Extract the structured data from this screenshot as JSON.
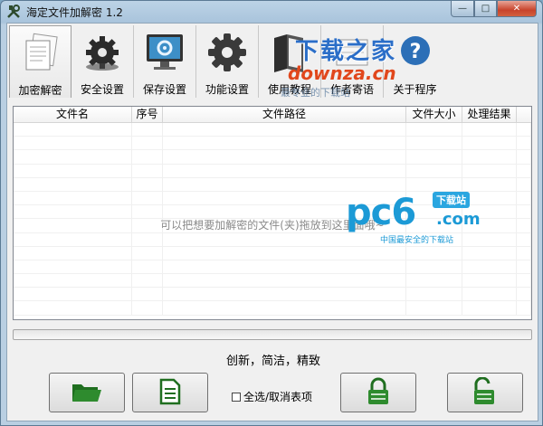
{
  "window": {
    "title": "海定文件加解密 1.2",
    "controls": [
      "minimize",
      "maximize",
      "close"
    ]
  },
  "toolbar": {
    "items": [
      {
        "label": "加密解密",
        "icon": "documents-icon",
        "active": true
      },
      {
        "label": "安全设置",
        "icon": "gears-icon",
        "active": false
      },
      {
        "label": "保存设置",
        "icon": "monitor-settings-icon",
        "active": false
      },
      {
        "label": "功能设置",
        "icon": "gear-icon",
        "active": false
      },
      {
        "label": "使用教程",
        "icon": "book-icon",
        "active": false
      },
      {
        "label": "作者寄语",
        "icon": "letter-icon",
        "active": false
      },
      {
        "label": "关于程序",
        "icon": "help-icon",
        "active": false
      }
    ]
  },
  "watermarks": {
    "top_title": "下载之家",
    "top_url": "downza.cn",
    "top_slogan": "最专业的下载站",
    "pc6_main": "pc6",
    "pc6_badge": "下载站",
    "pc6_domain": ".com",
    "pc6_tagline": "中国最安全的下载站"
  },
  "table": {
    "columns": [
      "文件名",
      "序号",
      "文件路径",
      "文件大小",
      "处理结果"
    ],
    "drop_hint": "可以把想要加解密的文件(夹)拖放到这里面哦~"
  },
  "progress": {
    "value": 0
  },
  "footer": {
    "slogan": "创新，简洁，精致",
    "select_all_label": "全选/取消表项",
    "select_all_checked": false
  },
  "colors": {
    "accent_green": "#2e8b2e",
    "titlebar": "#b9cfe2",
    "close_button": "#c8432b"
  }
}
